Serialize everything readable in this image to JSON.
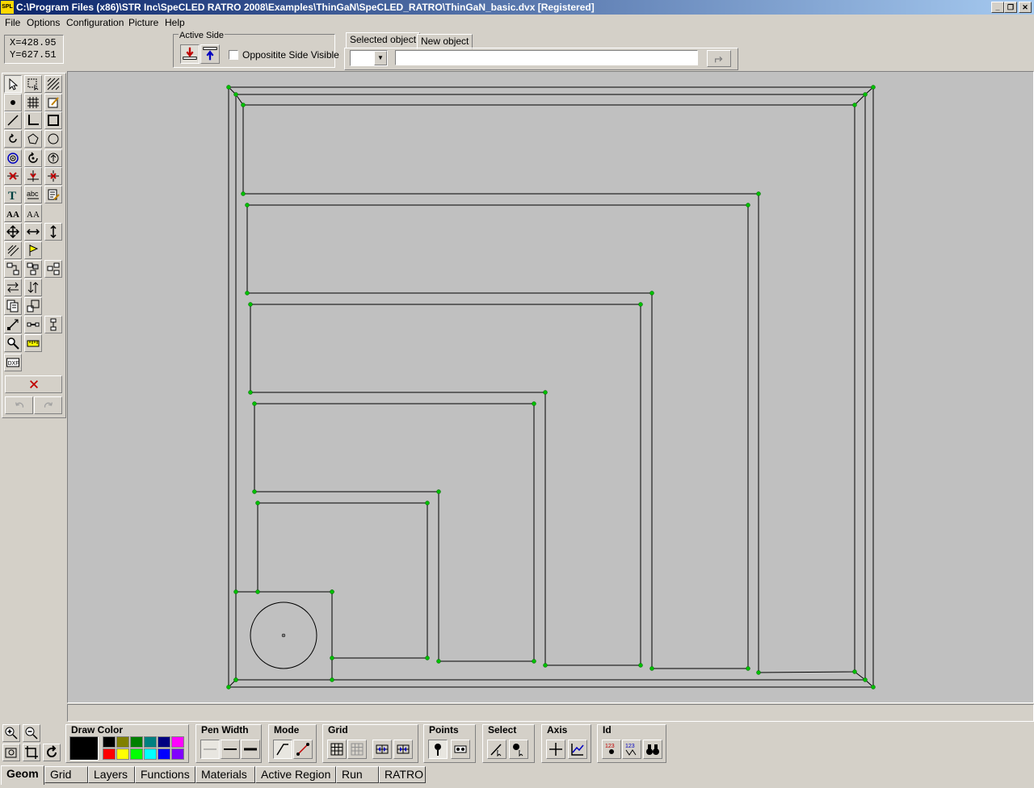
{
  "window": {
    "title": "C:\\Program Files (x86)\\STR Inc\\SpeCLED RATRO 2008\\Examples\\ThinGaN\\SpeCLED_RATRO\\ThinGaN_basic.dvx  [Registered]",
    "app_icon": "SPL"
  },
  "menu": [
    "File",
    "Options",
    "Configuration",
    "Picture",
    "Help"
  ],
  "coords": {
    "x": "X=428.95",
    "y": "Y=627.51"
  },
  "active_side": {
    "label": "Active Side",
    "checkbox_label": "Oppositite Side Visible",
    "checked": false
  },
  "object_panel": {
    "tabs": [
      "Selected object",
      "New object"
    ],
    "active_tab": 0,
    "combo_value": "",
    "text_value": ""
  },
  "toolbox": {
    "icons": [
      "select-arrow-icon",
      "select-rect-icon",
      "hatch-icon",
      "point-icon",
      "grid-icon",
      "edit-icon",
      "line-icon",
      "polyline-icon",
      "rectangle-icon",
      "rotate-icon",
      "polygon-icon",
      "circle-icon",
      "spiral-icon",
      "rotate2-icon",
      "cycle-icon",
      "cross-icon",
      "split-icon",
      "delete-icon",
      "text-icon",
      "abc-icon",
      "text-edit-icon",
      "font-a-icon",
      "font-b-icon",
      "move-icon",
      "move-h-icon",
      "move-v-icon",
      "stretch-icon",
      "flag-icon",
      "layer-icon",
      "layer2-icon",
      "layer3-icon",
      "flip-h-icon",
      "flip-v-icon",
      "copy-icon",
      "scale-icon",
      "node-icon",
      "connect-icon",
      "tree-icon",
      "zoom-find-icon",
      "ruler-icon",
      "dxf-icon"
    ],
    "dxf_label": "DXF",
    "text_label": "T",
    "abc_label": "abc",
    "font_a_label": "AA",
    "font_b_label": "AA"
  },
  "bottom_tools": {
    "draw_color": "Draw Color",
    "pen_width": "Pen Width",
    "mode": "Mode",
    "grid": "Grid",
    "points": "Points",
    "select": "Select",
    "axis": "Axis",
    "id": "Id",
    "current_color": "#000000",
    "palette": [
      "#000000",
      "#808000",
      "#008000",
      "#008080",
      "#000080",
      "#ff00ff",
      "#ff0000",
      "#ffff00",
      "#00ff00",
      "#00ffff",
      "#0000ff",
      "#8000ff"
    ]
  },
  "bottom_tabs": [
    "Geom",
    "Grid",
    "Layers",
    "Functions",
    "Materials",
    "Active Region",
    "Run",
    "RATRO"
  ],
  "active_bottom_tab": 0,
  "colors": {
    "canvas": "#c0c0c0",
    "node": "#00c000",
    "line": "#000000"
  }
}
